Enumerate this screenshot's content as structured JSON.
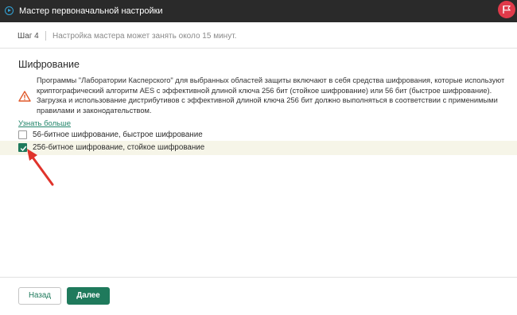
{
  "window": {
    "title": "Мастер первоначальной настройки",
    "app_icon": "play-circle-icon",
    "flag_icon": "flag-icon"
  },
  "step": {
    "label": "Шаг 4",
    "note": "Настройка мастера может занять около 15 минут."
  },
  "section": {
    "title": "Шифрование",
    "warning_icon": "warning-triangle-icon",
    "notice": "Программы \"Лаборатории Касперского\" для выбранных областей защиты включают в себя средства шифрования, которые используют криптографический алгоритм AES с эффективной длиной ключа 256 бит (стойкое шифрование) или 56 бит (быстрое шифрование). Загрузка и использование дистрибутивов с эффективной длиной ключа 256 бит должно выполняться в соответствии с применимыми правилами и законодательством.",
    "learn_more": "Узнать больше"
  },
  "options": [
    {
      "label": "56-битное шифрование, быстрое шифрование",
      "checked": false
    },
    {
      "label": "256-битное шифрование, стойкое шифрование",
      "checked": true
    }
  ],
  "buttons": {
    "back": "Назад",
    "next": "Далее"
  },
  "colors": {
    "accent": "#1f7a5c",
    "titlebar": "#2a2a2a",
    "flag": "#e03a4a",
    "warning": "#e05a2b",
    "annotation_arrow": "#e0332b"
  }
}
